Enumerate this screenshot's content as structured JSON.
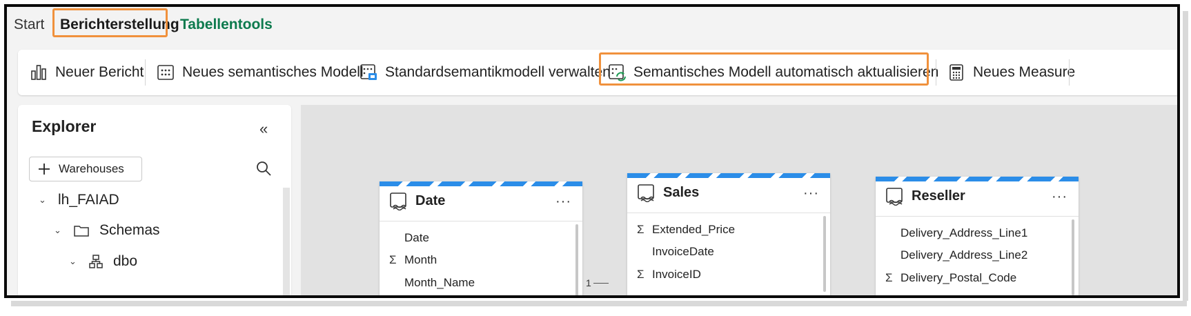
{
  "tabs": [
    {
      "label": "Start"
    },
    {
      "label": "Berichterstellung"
    },
    {
      "label": "Tabellentools"
    }
  ],
  "toolbar": {
    "new_report": "Neuer Bericht",
    "new_semantic_model": "Neues semantisches Modell",
    "manage_default_model": "Standardsemantikmodell verwalten",
    "auto_update_model": "Semantisches Modell automatisch aktualisieren",
    "new_measure": "Neues Measure"
  },
  "explorer": {
    "title": "Explorer",
    "add_button": "Warehouses",
    "tree": [
      {
        "label": "lh_FAIAD"
      },
      {
        "label": "Schemas"
      },
      {
        "label": "dbo"
      }
    ]
  },
  "tables": [
    {
      "name": "Date",
      "fields": [
        {
          "label": "Date",
          "sigma": ""
        },
        {
          "label": "Month",
          "sigma": "Σ"
        },
        {
          "label": "Month_Name",
          "sigma": ""
        }
      ]
    },
    {
      "name": "Sales",
      "fields": [
        {
          "label": "Extended_Price",
          "sigma": "Σ"
        },
        {
          "label": "InvoiceDate",
          "sigma": ""
        },
        {
          "label": "InvoiceID",
          "sigma": "Σ"
        }
      ]
    },
    {
      "name": "Reseller",
      "fields": [
        {
          "label": "Delivery_Address_Line1",
          "sigma": ""
        },
        {
          "label": "Delivery_Address_Line2",
          "sigma": ""
        },
        {
          "label": "Delivery_Postal_Code",
          "sigma": "Σ"
        }
      ]
    }
  ],
  "relationship_label": "1",
  "more_label": "···",
  "colors": {
    "highlight": "#f0913c",
    "accent_green": "#0c7a4d",
    "stripe_blue": "#2b8de8"
  }
}
